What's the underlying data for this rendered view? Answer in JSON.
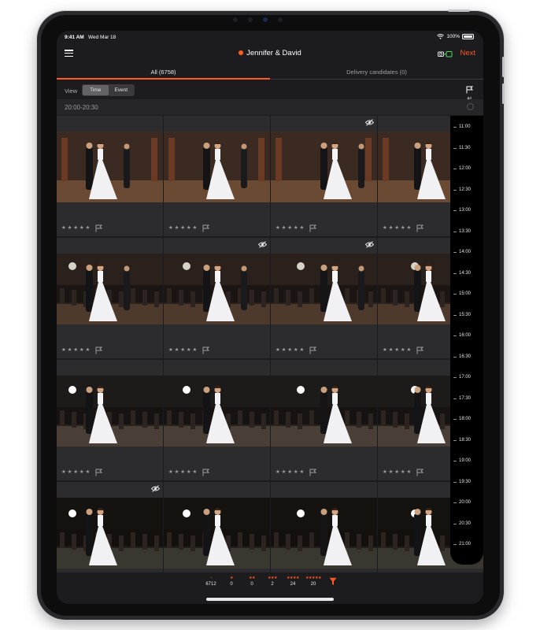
{
  "status_bar": {
    "time": "9:41 AM",
    "date": "Wed Mar 18",
    "battery": "100%"
  },
  "nav": {
    "title": "Jennifer & David",
    "next_label": "Next"
  },
  "tabs": [
    {
      "label": "All (6758)"
    },
    {
      "label": "Delivery candidates (0)"
    }
  ],
  "toolbar": {
    "view_label": "View",
    "time_label": "Time",
    "event_label": "Event",
    "flag_all_label": "All"
  },
  "section": {
    "label": "20:00-20:30"
  },
  "colors": {
    "accent": "#ff5a1f",
    "background": "#1c1c1e",
    "cell": "#2c2c2e"
  },
  "photos": [
    {
      "hidden": false,
      "stars": "★ ★ ★ ★ ★"
    },
    {
      "hidden": false,
      "stars": "★ ★ ★ ★ ★"
    },
    {
      "hidden": true,
      "stars": "★ ★ ★ ★ ★"
    },
    {
      "hidden": false,
      "stars": "★ ★ ★ ★ ★"
    },
    {
      "hidden": false,
      "stars": "★ ★ ★ ★ ★"
    },
    {
      "hidden": true,
      "stars": "★ ★ ★ ★ ★"
    },
    {
      "hidden": true,
      "stars": "★ ★ ★ ★ ★"
    },
    {
      "hidden": false,
      "stars": "★ ★ ★ ★ ★"
    },
    {
      "hidden": false,
      "stars": "★ ★ ★ ★ ★"
    },
    {
      "hidden": false,
      "stars": "★ ★ ★ ★ ★"
    },
    {
      "hidden": false,
      "stars": "★ ★ ★ ★ ★"
    },
    {
      "hidden": false,
      "stars": "★ ★ ★ ★ ★"
    },
    {
      "hidden": true,
      "stars": "★ ★ ★ ★ ★"
    },
    {
      "hidden": false,
      "stars": "★ ★ ★ ★ ★"
    },
    {
      "hidden": false,
      "stars": "★ ★ ★ ★ ★"
    },
    {
      "hidden": false,
      "stars": "★ ★ ★ ★ ★"
    }
  ],
  "timeline": [
    "11:00",
    "11:30",
    "12:00",
    "12:30",
    "13:00",
    "13:30",
    "14:00",
    "14:30",
    "15:00",
    "15:30",
    "16:00",
    "16:30",
    "17:00",
    "17:30",
    "18:00",
    "18:30",
    "19:00",
    "19:30",
    "20:00",
    "20:30",
    "21:00"
  ],
  "filters": [
    {
      "stars": "–",
      "count": "6712"
    },
    {
      "stars": "★",
      "count": "0"
    },
    {
      "stars": "★★",
      "count": "0"
    },
    {
      "stars": "★★★",
      "count": "2"
    },
    {
      "stars": "★★★★",
      "count": "24"
    },
    {
      "stars": "★★★★★",
      "count": "20"
    }
  ]
}
